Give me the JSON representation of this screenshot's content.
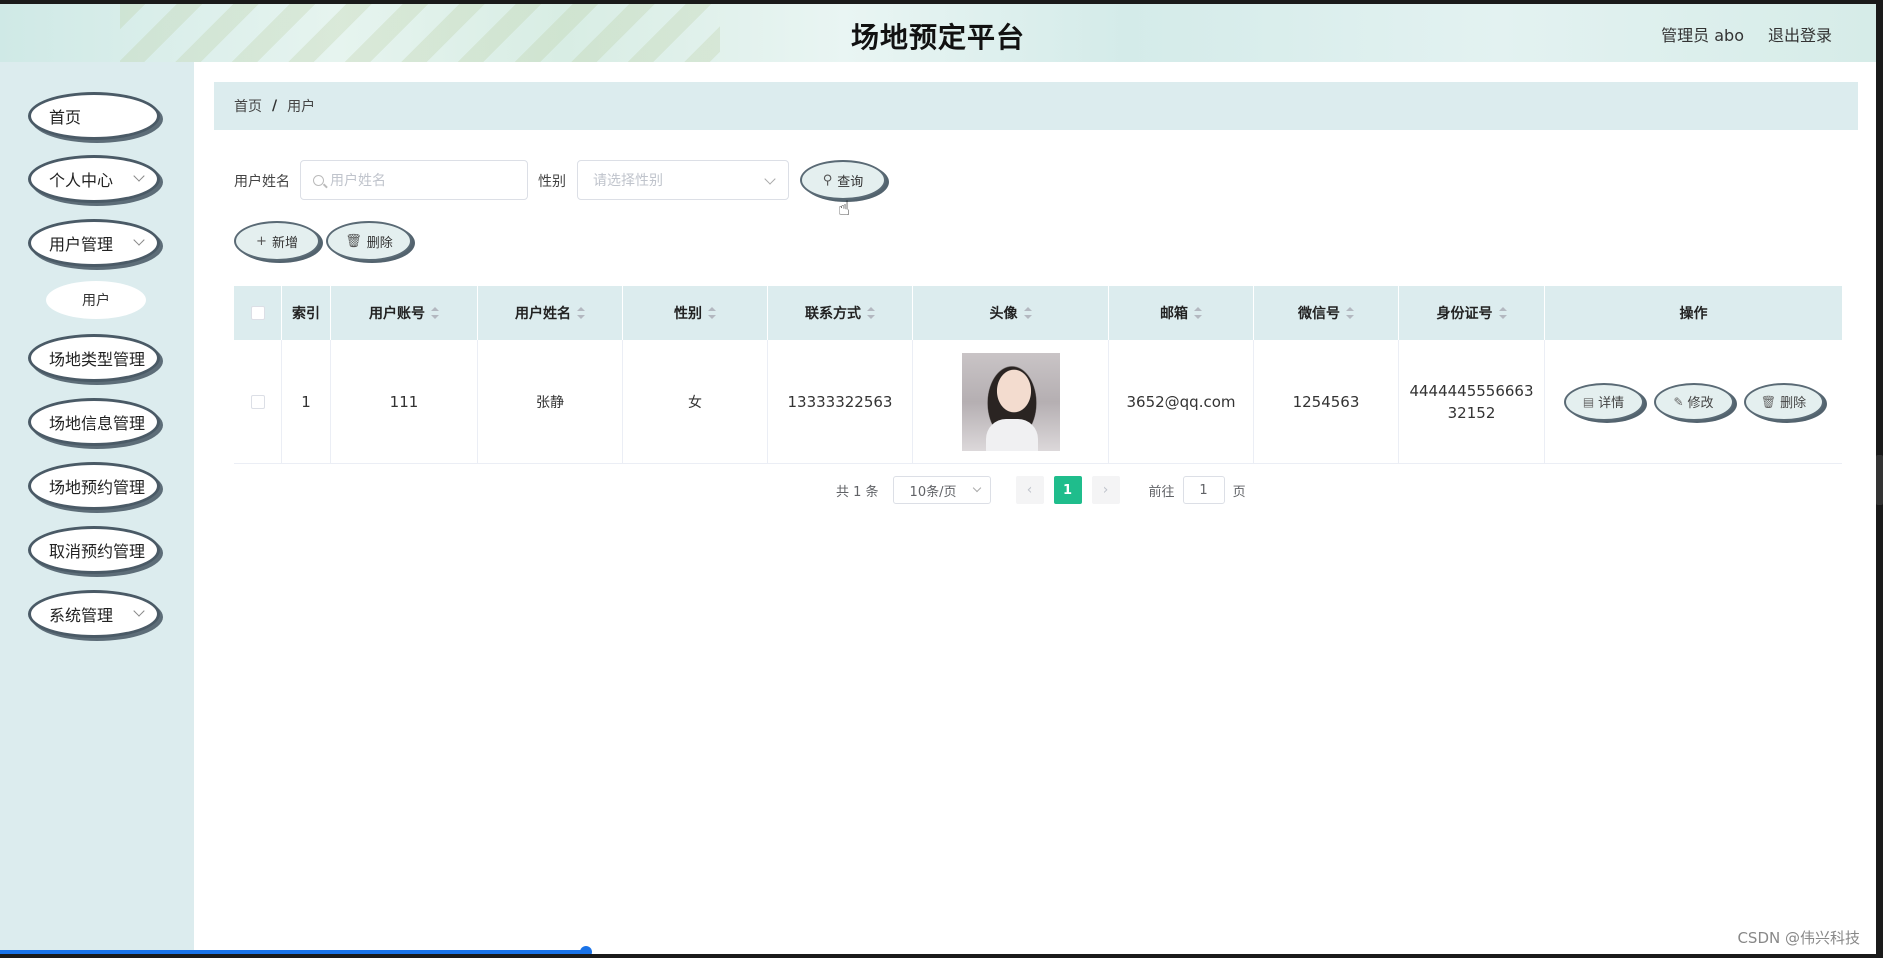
{
  "header": {
    "title": "场地预定平台",
    "admin": "管理员 abo",
    "logout": "退出登录"
  },
  "sidebar": {
    "items": [
      {
        "label": "首页",
        "has_children": false
      },
      {
        "label": "个人中心",
        "has_children": true
      },
      {
        "label": "用户管理",
        "has_children": true
      },
      {
        "label": "场地类型管理",
        "has_children": false
      },
      {
        "label": "场地信息管理",
        "has_children": false
      },
      {
        "label": "场地预约管理",
        "has_children": false
      },
      {
        "label": "取消预约管理",
        "has_children": false
      },
      {
        "label": "系统管理",
        "has_children": true
      }
    ],
    "sub_item": "用户"
  },
  "breadcrumb": {
    "home": "首页",
    "sep": "/",
    "current": "用户"
  },
  "search": {
    "name_label": "用户姓名",
    "name_placeholder": "用户姓名",
    "gender_label": "性别",
    "gender_placeholder": "请选择性别",
    "query_button": "查询"
  },
  "actions": {
    "add": "新增",
    "delete": "删除"
  },
  "table": {
    "columns": [
      "索引",
      "用户账号",
      "用户姓名",
      "性别",
      "联系方式",
      "头像",
      "邮箱",
      "微信号",
      "身份证号",
      "操作"
    ],
    "rows": [
      {
        "index": "1",
        "account": "111",
        "name": "张静",
        "gender": "女",
        "phone": "13333322563",
        "email": "3652@qq.com",
        "wechat": "1254563",
        "id_card": "444444555666332152",
        "ops": {
          "detail": "详情",
          "edit": "修改",
          "delete": "删除"
        }
      }
    ]
  },
  "pagination": {
    "total": "共 1 条",
    "page_size": "10条/页",
    "current": "1",
    "goto_label": "前往",
    "goto_value": "1",
    "page_unit": "页",
    "prev": "‹",
    "next": "›"
  },
  "watermark": "CSDN @伟兴科技",
  "colors": {
    "accent": "#1fbd8c",
    "sidebar_bg": "#dcecee",
    "header_bg": "#dcecee"
  }
}
